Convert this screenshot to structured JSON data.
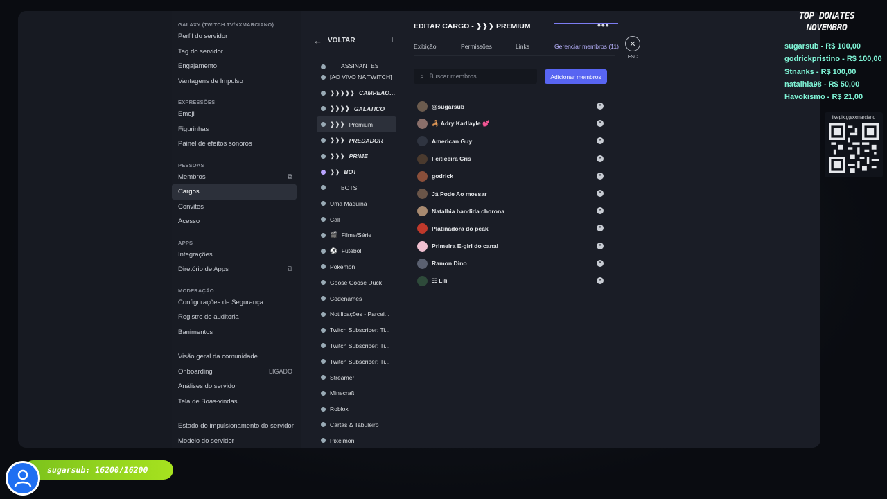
{
  "sidebar": {
    "server_header": "GALAXY (TWITCH.TV/XXMARCIANO)",
    "items_server": [
      "Perfil do servidor",
      "Tag do servidor",
      "Engajamento",
      "Vantagens de Impulso"
    ],
    "header_expressions": "EXPRESSÕES",
    "items_expressions": [
      "Emoji",
      "Figurinhas",
      "Painel de efeitos sonoros"
    ],
    "header_people": "PESSOAS",
    "items_people": [
      "Membros",
      "Cargos",
      "Convites",
      "Acesso"
    ],
    "header_apps": "APPS",
    "items_apps": [
      "Integrações",
      "Diretório de Apps"
    ],
    "header_moderation": "MODERAÇÃO",
    "items_moderation": [
      "Configurações de Segurança",
      "Registro de auditoria",
      "Banimentos"
    ],
    "items_community": [
      "Visão geral da comunidade",
      "Onboarding",
      "Análises do servidor",
      "Tela de Boas-vindas"
    ],
    "onboarding_status": "LIGADO",
    "items_bottom": [
      "Estado do impulsionamento do servidor",
      "Modelo do servidor"
    ],
    "active_item": "Cargos"
  },
  "roles": {
    "back_label": "VOLTAR",
    "plus_icon": "+",
    "items": [
      {
        "label": "ASSINANTES",
        "prefix": ""
      },
      {
        "label": "[AO VIVO NA TWITCH]",
        "prefix": ""
      },
      {
        "label": "CAMPEAO D...",
        "prefix": "❱❱❱❱❱"
      },
      {
        "label": "GALATICO",
        "prefix": "❱❱❱❱"
      },
      {
        "label": "Premium",
        "prefix": "❱❱❱"
      },
      {
        "label": "PREDADOR",
        "prefix": "❱❱❱"
      },
      {
        "label": "PRIME",
        "prefix": "❱❱❱"
      },
      {
        "label": "BOT",
        "prefix": "❱❱"
      },
      {
        "label": "BOTS",
        "prefix": ""
      },
      {
        "label": "Uma Máquina",
        "prefix": ""
      },
      {
        "label": "Call",
        "prefix": ""
      },
      {
        "label": "Filme/Série",
        "prefix": "🎬"
      },
      {
        "label": "Futebol",
        "prefix": "⚽"
      },
      {
        "label": "Pokemon",
        "prefix": ""
      },
      {
        "label": "Goose Goose Duck",
        "prefix": ""
      },
      {
        "label": "Codenames",
        "prefix": ""
      },
      {
        "label": "Notificações - Parcei...",
        "prefix": ""
      },
      {
        "label": "Twitch Subscriber: Ti...",
        "prefix": ""
      },
      {
        "label": "Twitch Subscriber: Ti...",
        "prefix": ""
      },
      {
        "label": "Twitch Subscriber: Ti...",
        "prefix": ""
      },
      {
        "label": "Streamer",
        "prefix": ""
      },
      {
        "label": "Minecraft",
        "prefix": ""
      },
      {
        "label": "Roblox",
        "prefix": ""
      },
      {
        "label": "Cartas & Tabuleiro",
        "prefix": ""
      },
      {
        "label": "Pixelmon",
        "prefix": ""
      }
    ],
    "active_index": 4
  },
  "main": {
    "title": "EDITAR CARGO - ❱❱❱ PREMIUM",
    "more_label": "•••",
    "close_label": "✕",
    "esc_label": "ESC",
    "tabs": [
      "Exibição",
      "Permissões",
      "Links",
      "Gerenciar membros (11)"
    ],
    "active_tab": 3,
    "search_placeholder": "Buscar membros",
    "add_members_label": "Adicionar membros",
    "members": [
      {
        "name": "@sugarsub",
        "avatar_color": "#6b5b4e"
      },
      {
        "name": "🦂 Adry Karllayle 💕",
        "avatar_color": "#8a6f6a"
      },
      {
        "name": "American Guy",
        "avatar_color": "#2f3440"
      },
      {
        "name": "Feiticeira Cris",
        "avatar_color": "#4a3a2e"
      },
      {
        "name": "godrick",
        "avatar_color": "#8a4f3a"
      },
      {
        "name": "Já Pode Ao mossar",
        "avatar_color": "#6a5548"
      },
      {
        "name": "Natalhia bandida chorona",
        "avatar_color": "#a88a70"
      },
      {
        "name": "Platinadora do peak",
        "avatar_color": "#c0392b"
      },
      {
        "name": "Primeira E-girl do canal",
        "avatar_color": "#f0c0d0"
      },
      {
        "name": "Ramon Dino",
        "avatar_color": "#5a6070"
      },
      {
        "name": "☷ Lili",
        "avatar_color": "#2e4a3a"
      }
    ]
  },
  "overlay": {
    "top_donates_title": "TOP DONATES",
    "top_donates_month": "NOVEMBRO",
    "donates": [
      "sugarsub - R$ 100,00",
      "godrickpristino - R$ 100,00",
      "Stnanks - R$ 100,00",
      "natalhia98 - R$ 50,00",
      "Havokismo - R$ 21,00"
    ],
    "qr_label": "livepix.gg/xxmarciano",
    "goal_text": "sugarsub: 16200/16200",
    "goal_progress": 1.0,
    "goal_color": "#8fd11f"
  }
}
